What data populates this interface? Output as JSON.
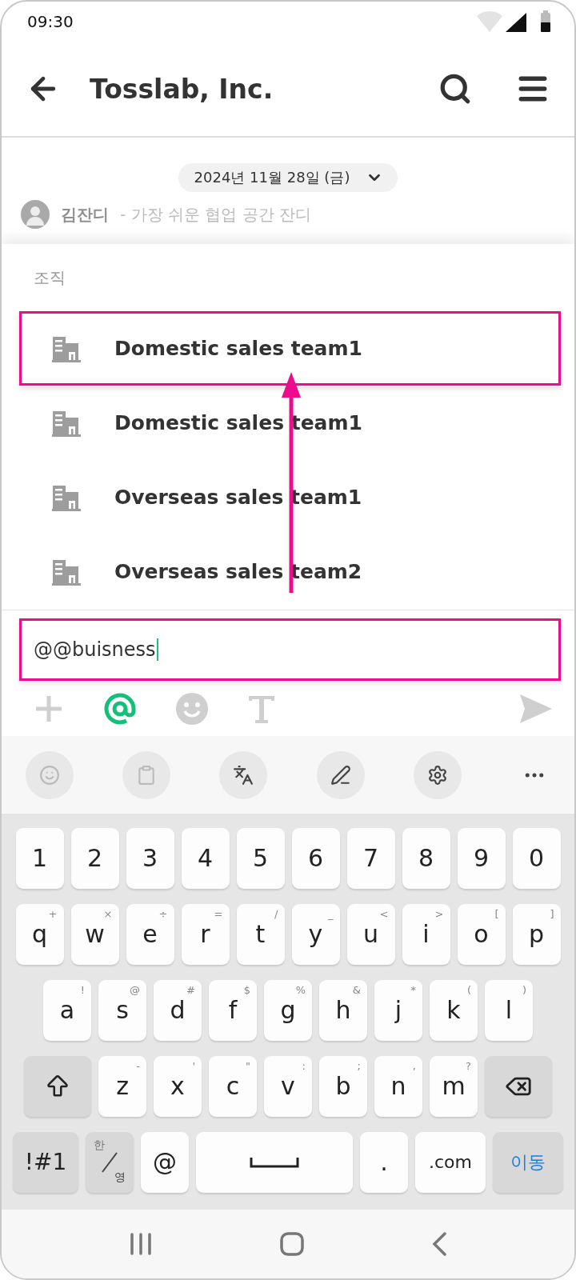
{
  "status_bar": {
    "time": "09:30"
  },
  "header": {
    "title": "Tosslab, Inc."
  },
  "date_chip": {
    "label": "2024년 11월 28일 (금)"
  },
  "message": {
    "sender": "김잔디",
    "preview": "- 가장 쉬운 협업 공간 잔디"
  },
  "mention_panel": {
    "section": "조직",
    "items": [
      {
        "name": "Domestic sales team1",
        "selected": true
      },
      {
        "name": "Domestic sales team1",
        "selected": false
      },
      {
        "name": "Overseas sales team1",
        "selected": false
      },
      {
        "name": "Overseas sales team2",
        "selected": false
      }
    ]
  },
  "composer": {
    "value": "@@buisness",
    "highlighted": true,
    "tools": [
      {
        "kind": "plus",
        "selected": false
      },
      {
        "kind": "mention",
        "selected": true
      },
      {
        "kind": "emoji",
        "selected": false
      },
      {
        "kind": "text",
        "selected": false
      },
      {
        "kind": "send",
        "selected": false
      }
    ]
  },
  "keyboard": {
    "toolbar": [
      {
        "kind": "emoji"
      },
      {
        "kind": "clipboard"
      },
      {
        "kind": "translate"
      },
      {
        "kind": "handwriting"
      },
      {
        "kind": "settings"
      },
      {
        "kind": "more"
      }
    ],
    "rows": [
      {
        "keys": [
          {
            "kind": "char",
            "label": "1"
          },
          {
            "kind": "char",
            "label": "2"
          },
          {
            "kind": "char",
            "label": "3"
          },
          {
            "kind": "char",
            "label": "4"
          },
          {
            "kind": "char",
            "label": "5"
          },
          {
            "kind": "char",
            "label": "6"
          },
          {
            "kind": "char",
            "label": "7"
          },
          {
            "kind": "char",
            "label": "8"
          },
          {
            "kind": "char",
            "label": "9"
          },
          {
            "kind": "char",
            "label": "0"
          }
        ]
      },
      {
        "keys": [
          {
            "kind": "char",
            "label": "q",
            "hint": "+"
          },
          {
            "kind": "char",
            "label": "w",
            "hint": "×"
          },
          {
            "kind": "char",
            "label": "e",
            "hint": "÷"
          },
          {
            "kind": "char",
            "label": "r",
            "hint": "="
          },
          {
            "kind": "char",
            "label": "t",
            "hint": "/"
          },
          {
            "kind": "char",
            "label": "y",
            "hint": "_"
          },
          {
            "kind": "char",
            "label": "u",
            "hint": "<"
          },
          {
            "kind": "char",
            "label": "i",
            "hint": ">"
          },
          {
            "kind": "char",
            "label": "o",
            "hint": "["
          },
          {
            "kind": "char",
            "label": "p",
            "hint": "]"
          }
        ]
      },
      {
        "keys": [
          {
            "kind": "char",
            "label": "a",
            "hint": "!"
          },
          {
            "kind": "char",
            "label": "s",
            "hint": "@"
          },
          {
            "kind": "char",
            "label": "d",
            "hint": "#"
          },
          {
            "kind": "char",
            "label": "f",
            "hint": "$"
          },
          {
            "kind": "char",
            "label": "g",
            "hint": "%"
          },
          {
            "kind": "char",
            "label": "h",
            "hint": "&"
          },
          {
            "kind": "char",
            "label": "j",
            "hint": "*"
          },
          {
            "kind": "char",
            "label": "k",
            "hint": "("
          },
          {
            "kind": "char",
            "label": "l",
            "hint": ")"
          }
        ]
      },
      {
        "keys": [
          {
            "kind": "shift"
          },
          {
            "kind": "char",
            "label": "z",
            "hint": "-"
          },
          {
            "kind": "char",
            "label": "x",
            "hint": "'"
          },
          {
            "kind": "char",
            "label": "c",
            "hint": "\""
          },
          {
            "kind": "char",
            "label": "v",
            "hint": ":"
          },
          {
            "kind": "char",
            "label": "b",
            "hint": ";"
          },
          {
            "kind": "char",
            "label": "n",
            "hint": ","
          },
          {
            "kind": "char",
            "label": "m",
            "hint": "?"
          },
          {
            "kind": "backspace"
          }
        ]
      },
      {
        "keys": [
          {
            "kind": "symbols",
            "label": "!#1"
          },
          {
            "kind": "lang",
            "label": "한",
            "label2": "영"
          },
          {
            "kind": "char",
            "label": "@"
          },
          {
            "kind": "space"
          },
          {
            "kind": "char",
            "label": "."
          },
          {
            "kind": "wide",
            "label": ".com"
          },
          {
            "kind": "enter",
            "label": "이동"
          }
        ]
      }
    ]
  }
}
